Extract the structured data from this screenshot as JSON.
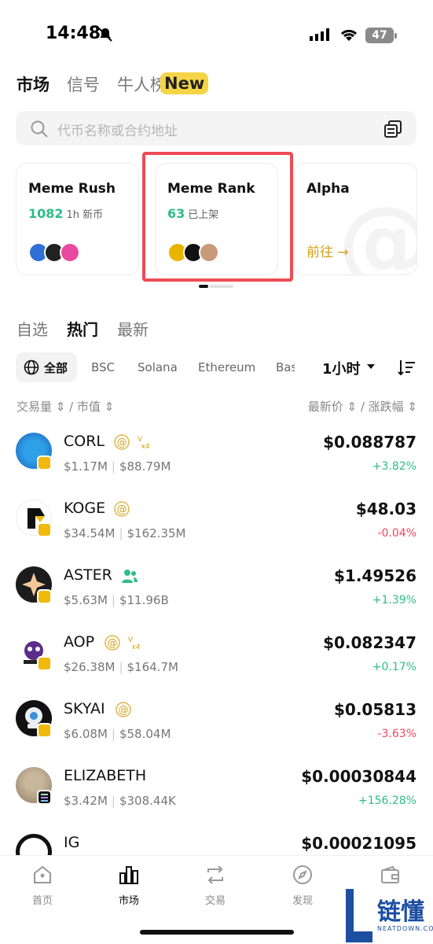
{
  "status_bar": {
    "time": "14:48",
    "battery": "47"
  },
  "top_tabs": {
    "market": "市场",
    "signal": "信号",
    "rank": "牛人榜",
    "new_badge": "New"
  },
  "search": {
    "placeholder": "代币名称或合约地址"
  },
  "cards": [
    {
      "title": "Meme Rush",
      "count": "1082",
      "sub": "1h 新币"
    },
    {
      "title": "Meme Rank",
      "count": "63",
      "sub": "已上架"
    },
    {
      "title": "Alpha",
      "action": "前往 →"
    }
  ],
  "section_tabs": {
    "favorites": "自选",
    "hot": "热门",
    "latest": "最新"
  },
  "chains": {
    "all": "全部",
    "bsc": "BSC",
    "solana": "Solana",
    "ethereum": "Ethereum",
    "base": "Bas",
    "timeframe": "1小时"
  },
  "columns": {
    "left": "交易量 ⇕ / 市值 ⇕",
    "right": "最新价 ⇕ / 涨跌幅 ⇕"
  },
  "tokens": [
    {
      "symbol": "CORL",
      "volume": "$1.17M",
      "mcap": "$88.79M",
      "price": "$0.088787",
      "change": "+3.82%",
      "direction": "up",
      "tags": [
        "alpha-icon",
        "x4-icon"
      ],
      "chain": "bsc"
    },
    {
      "symbol": "KOGE",
      "volume": "$34.54M",
      "mcap": "$162.35M",
      "price": "$48.03",
      "change": "-0.04%",
      "direction": "down",
      "tags": [
        "alpha-icon"
      ],
      "chain": "bsc"
    },
    {
      "symbol": "ASTER",
      "volume": "$5.63M",
      "mcap": "$11.96B",
      "price": "$1.49526",
      "change": "+1.39%",
      "direction": "up",
      "tags": [
        "users-icon"
      ],
      "chain": "bsc"
    },
    {
      "symbol": "AOP",
      "volume": "$26.38M",
      "mcap": "$164.7M",
      "price": "$0.082347",
      "change": "+0.17%",
      "direction": "up",
      "tags": [
        "alpha-icon",
        "x4-icon"
      ],
      "chain": "bsc"
    },
    {
      "symbol": "SKYAI",
      "volume": "$6.08M",
      "mcap": "$58.04M",
      "price": "$0.05813",
      "change": "-3.63%",
      "direction": "down",
      "tags": [
        "alpha-icon"
      ],
      "chain": "bsc"
    },
    {
      "symbol": "ELIZABETH",
      "volume": "$3.42M",
      "mcap": "$308.44K",
      "price": "$0.00030844",
      "change": "+156.28%",
      "direction": "up",
      "tags": [],
      "chain": "solana"
    },
    {
      "symbol": "IG",
      "price": "$0.00021095"
    }
  ],
  "nav": {
    "home": "首页",
    "market": "市场",
    "trade": "交易",
    "discover": "发现"
  },
  "watermark": {
    "text": "链懂",
    "sub": "NEATDOWN.COM"
  },
  "colors": {
    "up": "#2ebd85",
    "down": "#f6465d",
    "highlight": "#ee4b55",
    "brand": "#f0b90b"
  }
}
